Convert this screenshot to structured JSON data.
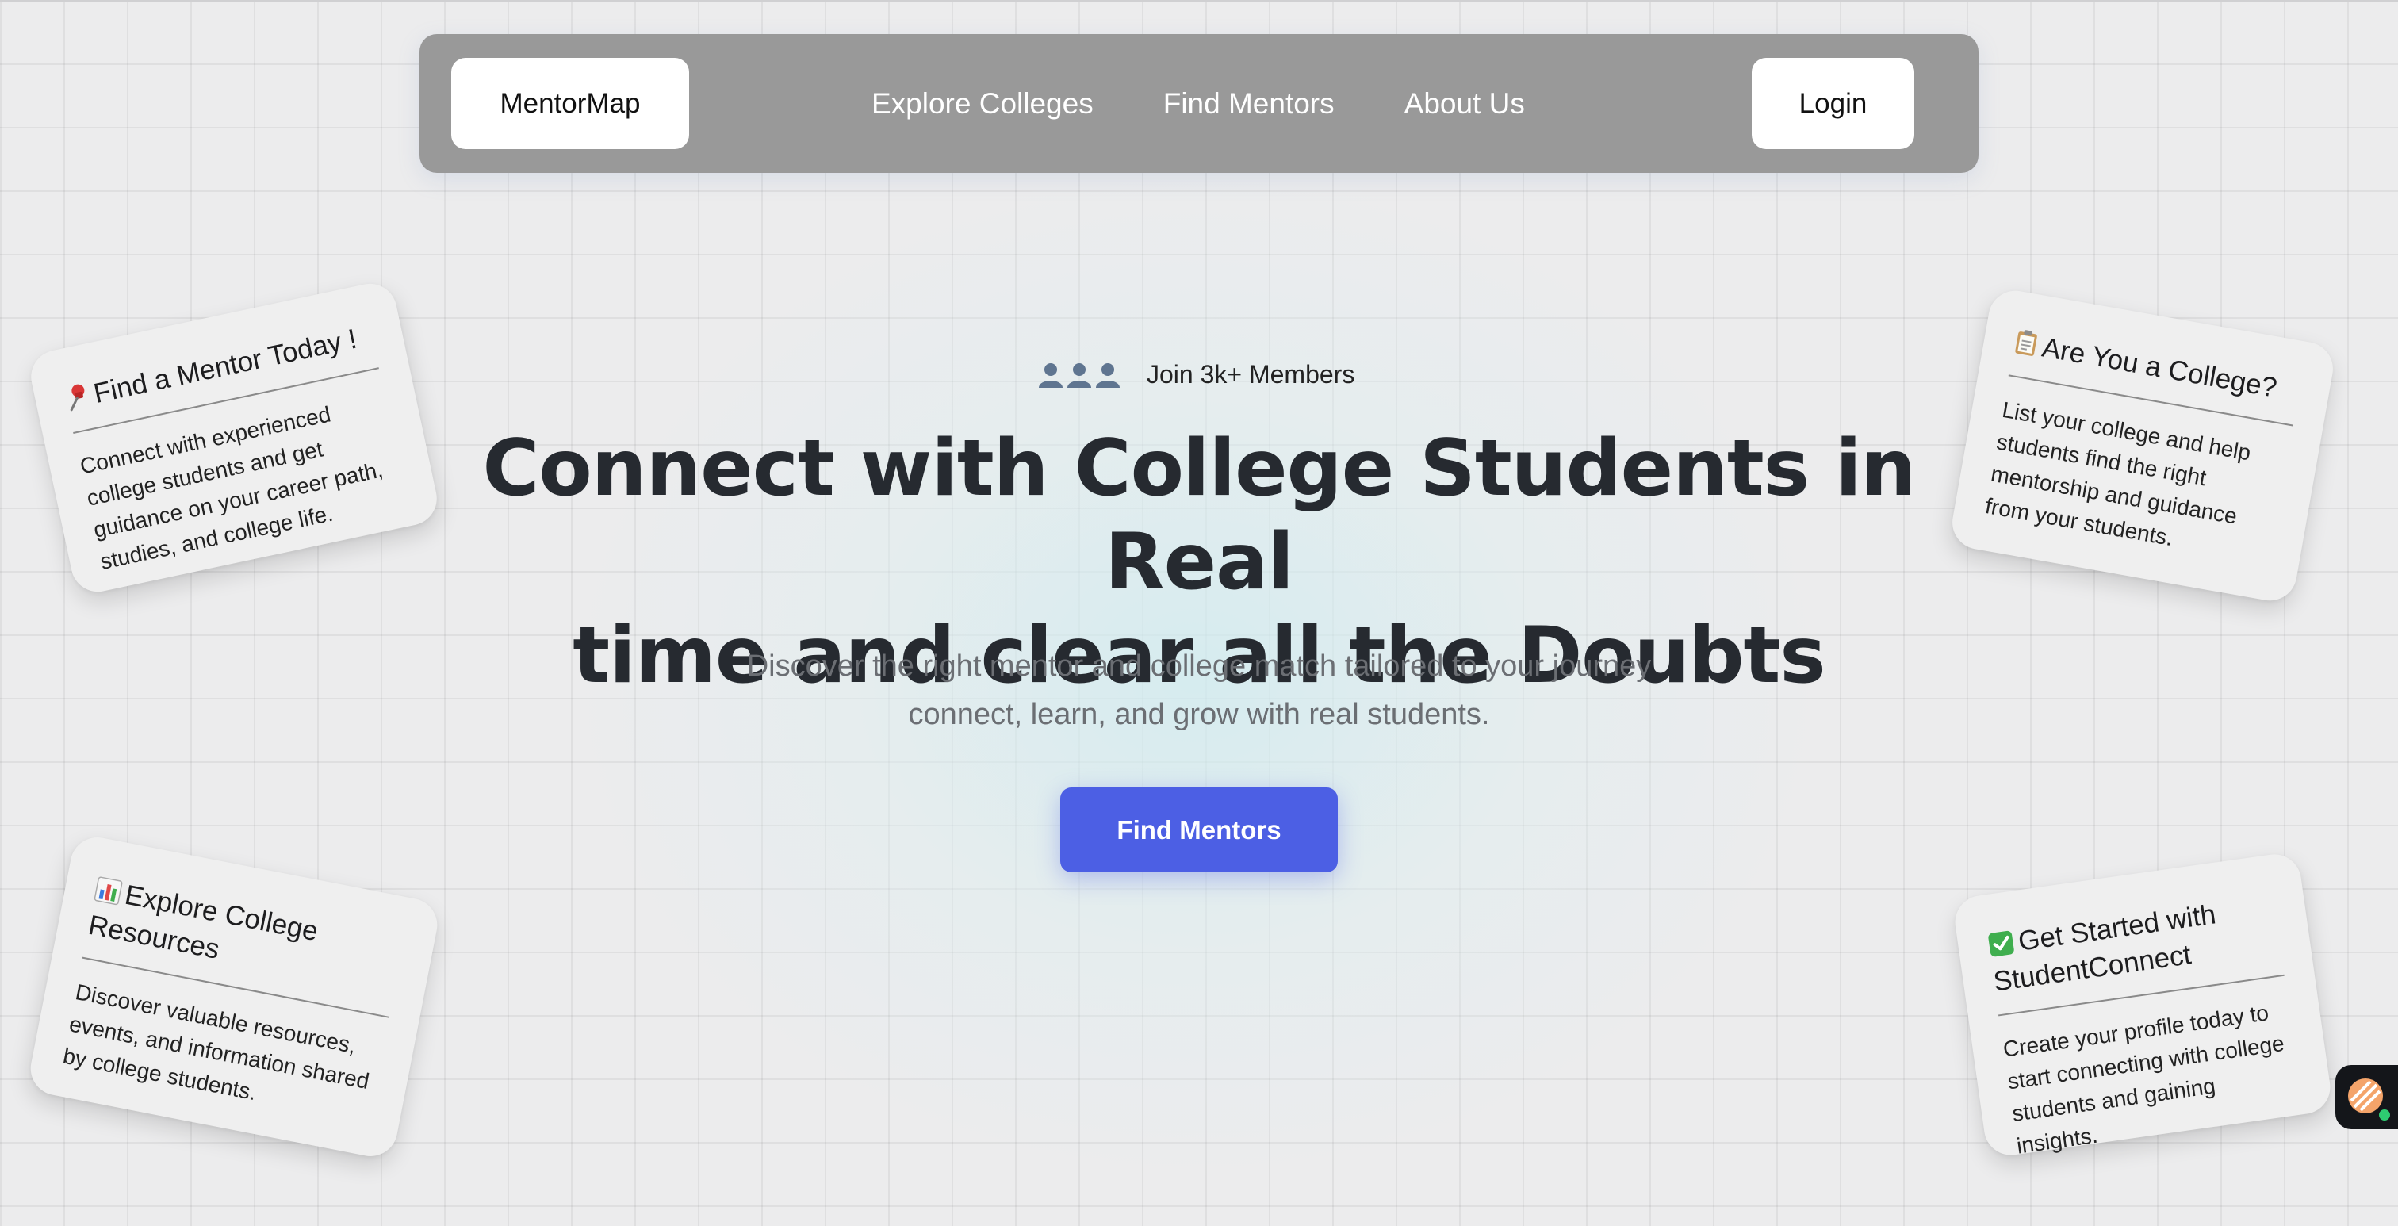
{
  "navbar": {
    "brand": "MentorMap",
    "links": [
      "Explore Colleges",
      "Find Mentors",
      "About Us"
    ],
    "login": "Login"
  },
  "hero": {
    "members_icon": "users-icon",
    "members_text": "Join 3k+ Members",
    "headline_line1": "Connect with College Students in Real",
    "headline_line2": "time and clear all the Doubts",
    "subtitle_line1": "Discover the right mentor and college match tailored to your journey",
    "subtitle_line2": "connect, learn, and grow with real students.",
    "cta": "Find Mentors",
    "cta_color": "#4c5fe4"
  },
  "cards": [
    {
      "icon": "pushpin-icon",
      "title": "Find a Mentor Today !",
      "body": "Connect with experienced college students and get guidance on your career path, studies, and college life."
    },
    {
      "icon": "clipboard-icon",
      "title": "Are You a College?",
      "body": "List your college and help students find the right mentorship and guidance from your students."
    },
    {
      "icon": "bar-chart-icon",
      "title": "Explore College Resources",
      "body": "Discover valuable resources, events, and information shared by college students."
    },
    {
      "icon": "check-mark-icon",
      "title": "Get Started with StudentConnect",
      "body": "Create your profile today to start connecting with college students and gaining insights."
    }
  ],
  "chat_widget": {
    "icon": "chat-support-icon",
    "status_color": "#2ecc71"
  }
}
